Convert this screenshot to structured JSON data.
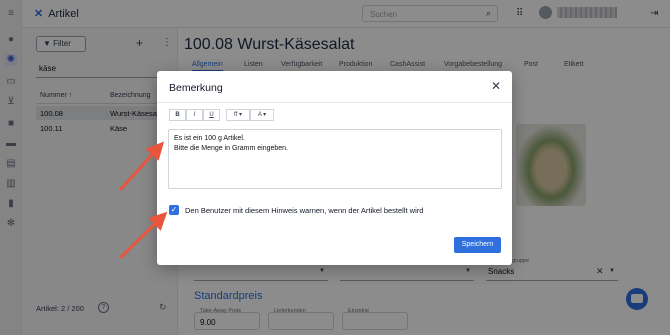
{
  "app": {
    "title": "Artikel",
    "search_placeholder": "Suchen"
  },
  "rail": {
    "icons": [
      "menu-icon",
      "person-icon",
      "settings-cog-icon",
      "truck-icon",
      "cart-icon",
      "box-icon",
      "factory-icon",
      "book-icon",
      "clipboard-icon",
      "bar-chart-icon",
      "gear-icon"
    ]
  },
  "list": {
    "filter_label": "Filter",
    "query": "käse",
    "columns": [
      "Nummer ↑",
      "Bezeichnung"
    ],
    "rows": [
      {
        "nr": "100.08",
        "name": "Wurst-Käsesal"
      },
      {
        "nr": "100.11",
        "name": "Käse"
      }
    ],
    "footer": "Artikel: 2 / 200"
  },
  "main": {
    "title": "100.08 Wurst-Käsesalat",
    "tabs": [
      "Allgemein",
      "Listen",
      "Verfügbarkeit",
      "Produktion",
      "CashAssist",
      "Vorgabebestellung",
      "Post",
      "Etikett"
    ],
    "group_label": "Warengruppe",
    "group_value": "Snacks",
    "section_title": "Standardpreis",
    "fields": [
      "Take-Away Preis",
      "Lieferkunden",
      "Einzelne"
    ],
    "price": "9.00"
  },
  "dialog": {
    "title": "Bemerkung",
    "toolbar": [
      "B",
      "I",
      "U",
      "ff ▾",
      "A ▾"
    ],
    "text_line1": "Es ist ein 100 g Artikel.",
    "text_line2": "Bitte die Menge in Gramm eingeben.",
    "checkbox_label": "Den Benutzer mit diesem Hinweis warnen, wenn der Artikel bestellt wird",
    "checkbox_checked": true,
    "save_label": "Speichern"
  },
  "colors": {
    "accent": "#2f6fde",
    "annotation": "#e8553c"
  }
}
